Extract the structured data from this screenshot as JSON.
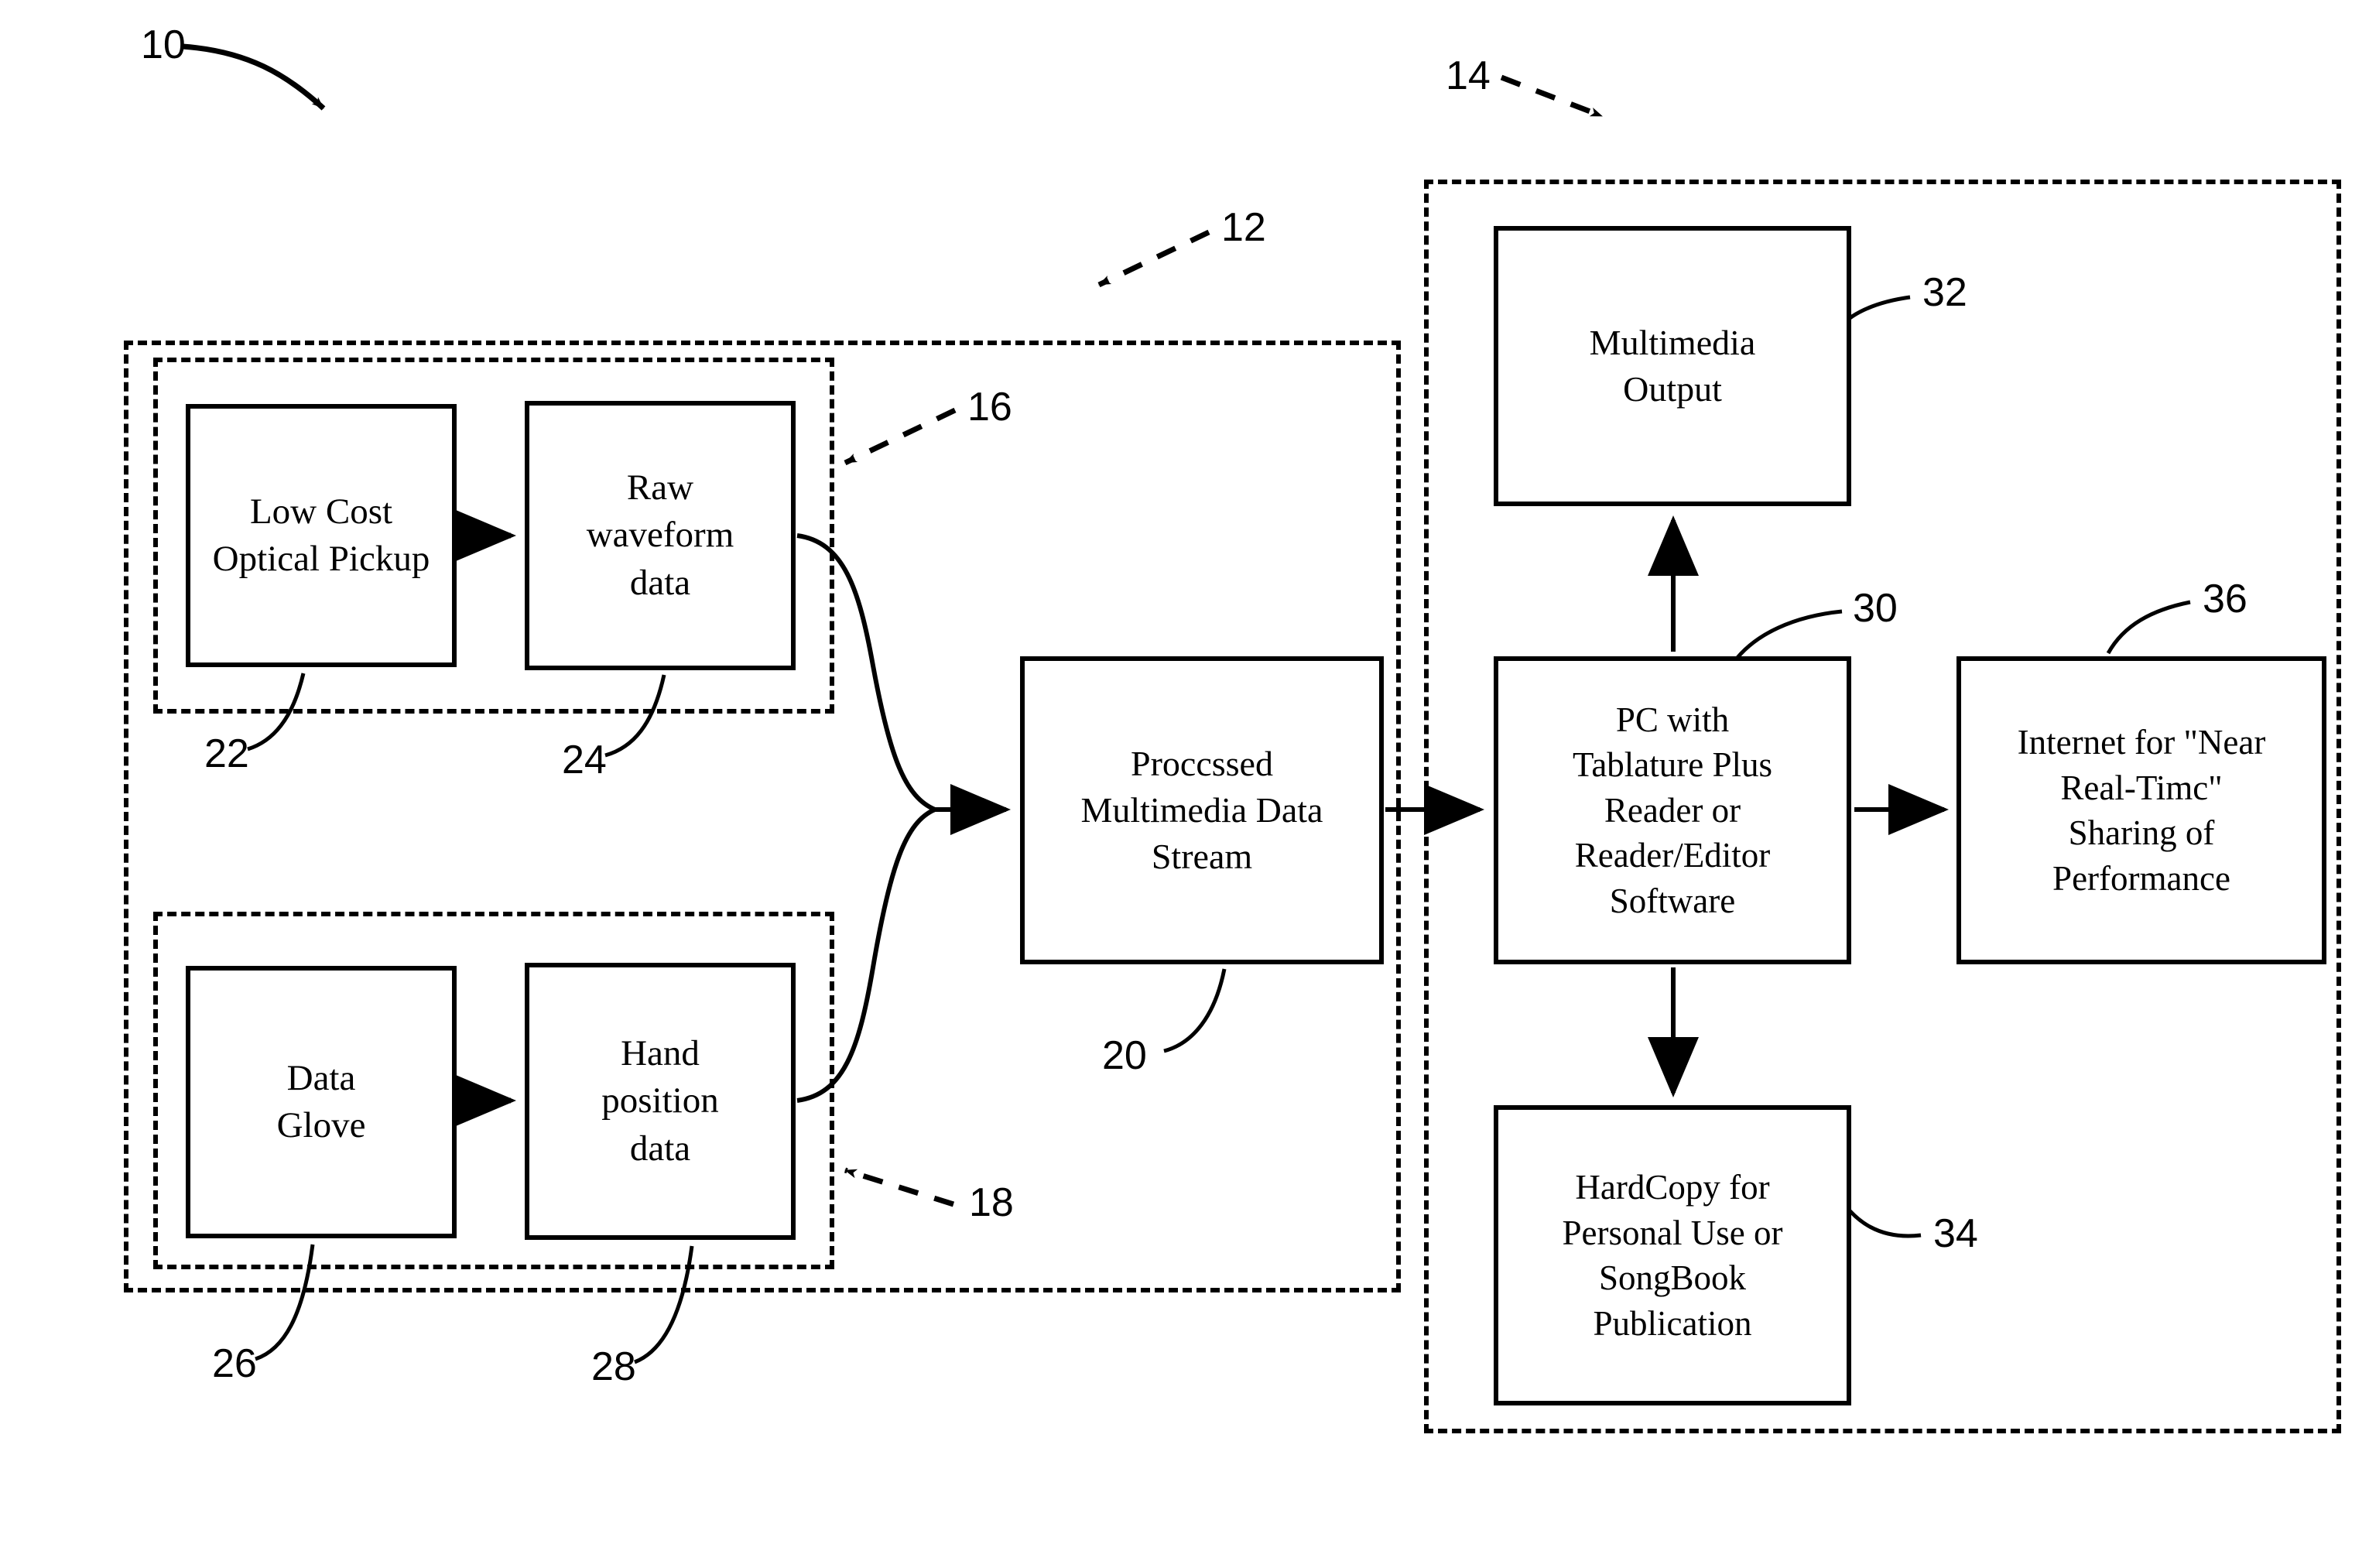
{
  "figure": {
    "type": "patent-block-diagram",
    "background_color": "#ffffff",
    "line_color": "#000000"
  },
  "boxes": {
    "optical_pickup": "Low Cost\nOptical Pickup",
    "raw_waveform": "Raw\nwaveform\ndata",
    "data_glove": "Data\nGlove",
    "hand_position": "Hand\nposition\ndata",
    "processed_stream": "Proccssed\nMultimedia Data\nStream",
    "multimedia_output": "Multimedia\nOutput",
    "pc_software": "PC with\nTablature Plus\nReader or\nReader/Editor\nSoftware",
    "internet_sharing": "Internet for \"Near\nReal-Timc\"\nSharing of\nPerformance",
    "hardcopy": "HardCopy for\nPersonal Use or\nSongBook\nPublication"
  },
  "reference_numerals": {
    "system": "10",
    "capture_section": "12",
    "playback_section": "14",
    "optical_subsystem": "16",
    "glove_subsystem": "18",
    "processed_stream": "20",
    "optical_pickup": "22",
    "raw_waveform": "24",
    "data_glove": "26",
    "hand_position": "28",
    "pc_software": "30",
    "multimedia_output": "32",
    "hardcopy": "34",
    "internet_sharing": "36"
  }
}
